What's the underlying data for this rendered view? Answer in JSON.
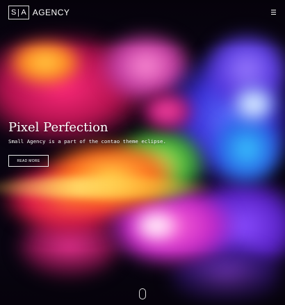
{
  "header": {
    "logo": {
      "letter_left": "S",
      "letter_right": "A",
      "wordmark": "AGENCY"
    },
    "menu_icon": "hamburger-menu-icon"
  },
  "hero": {
    "title": "Pixel Perfection",
    "subtitle": "Small Agency is a part of the contao theme eclipse.",
    "cta_label": "READ MORE",
    "scroll_icon": "mouse-scroll-icon"
  },
  "colors": {
    "text": "#ffffff",
    "background": "#07030c"
  }
}
